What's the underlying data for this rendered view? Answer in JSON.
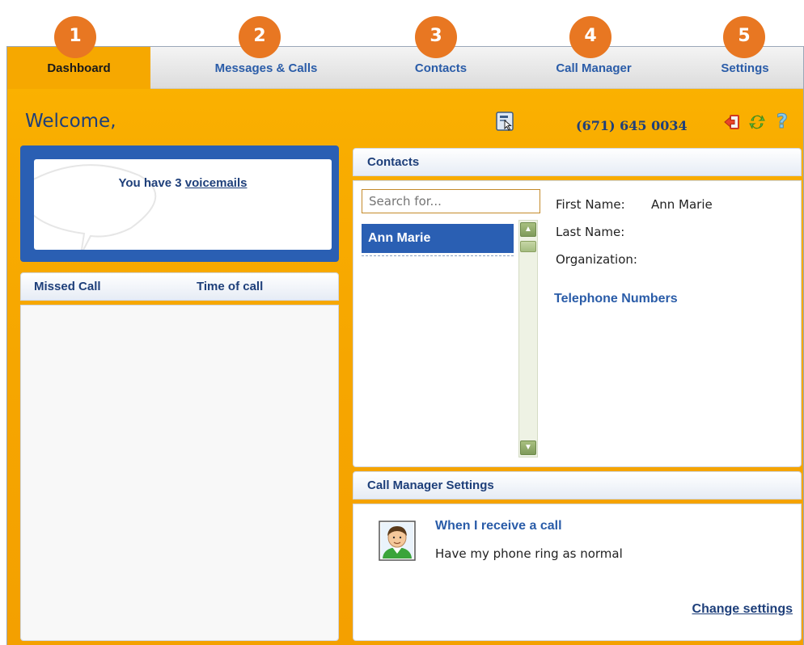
{
  "callouts": [
    "1",
    "2",
    "3",
    "4",
    "5"
  ],
  "tabs": [
    {
      "label": "Dashboard",
      "active": true
    },
    {
      "label": "Messages & Calls",
      "active": false
    },
    {
      "label": "Contacts",
      "active": false
    },
    {
      "label": "Call Manager",
      "active": false
    },
    {
      "label": "Settings",
      "active": false
    }
  ],
  "header": {
    "welcome": "Welcome,",
    "phone_number": "(671) 645 0034",
    "icons": [
      "contact-card-icon",
      "logout-icon",
      "refresh-icon",
      "help-icon"
    ]
  },
  "voicemail": {
    "prefix": "You have 3 ",
    "link": "voicemails"
  },
  "missed_calls": {
    "columns": [
      "Missed Call",
      "Time of call"
    ],
    "rows": []
  },
  "contacts": {
    "title": "Contacts",
    "search_placeholder": "Search for...",
    "list": [
      "Ann Marie"
    ],
    "details": {
      "first_name_label": "First Name:",
      "first_name_value": "Ann Marie",
      "last_name_label": "Last Name:",
      "last_name_value": "",
      "organization_label": "Organization:",
      "organization_value": ""
    },
    "telephone_heading": "Telephone Numbers"
  },
  "call_manager": {
    "title": "Call Manager Settings",
    "rule_title": "When I receive a call",
    "rule_description": "Have my phone ring as normal",
    "change_link": "Change settings"
  },
  "colors": {
    "accent_orange": "#f6a800",
    "badge_orange": "#e87722",
    "brand_blue": "#2a5fb3",
    "text_blue": "#1e3f7a"
  }
}
